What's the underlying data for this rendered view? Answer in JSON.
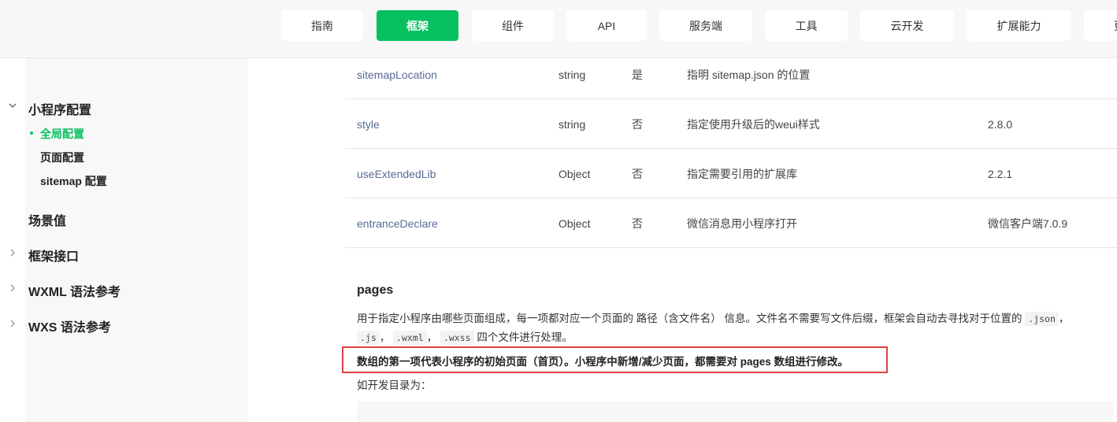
{
  "nav": {
    "items": [
      {
        "label": "指南",
        "active": false
      },
      {
        "label": "框架",
        "active": true
      },
      {
        "label": "组件",
        "active": false
      },
      {
        "label": "API",
        "active": false
      },
      {
        "label": "服务端",
        "active": false
      },
      {
        "label": "工具",
        "active": false
      },
      {
        "label": "云开发",
        "active": false
      },
      {
        "label": "扩展能力",
        "active": false
      },
      {
        "label": "更",
        "active": false
      }
    ],
    "accent": "#07c160"
  },
  "sidebar": {
    "section": "小程序配置",
    "subitems": [
      {
        "label": "全局配置",
        "active": true
      },
      {
        "label": "页面配置",
        "active": false
      },
      {
        "label": "sitemap 配置",
        "active": false
      }
    ],
    "items": [
      {
        "label": "场景值"
      },
      {
        "label": "框架接口"
      },
      {
        "label": "WXML 语法参考"
      },
      {
        "label": "WXS 语法参考"
      }
    ]
  },
  "table": {
    "rows": [
      {
        "name": "sitemapLocation",
        "type": "string",
        "required": "是",
        "desc": "指明 sitemap.json 的位置",
        "version": ""
      },
      {
        "name": "style",
        "type": "string",
        "required": "否",
        "desc": "指定使用升级后的weui样式",
        "version": "2.8.0"
      },
      {
        "name": "useExtendedLib",
        "type": "Object",
        "required": "否",
        "desc": "指定需要引用的扩展库",
        "version": "2.2.1"
      },
      {
        "name": "entranceDeclare",
        "type": "Object",
        "required": "否",
        "desc": "微信消息用小程序打开",
        "version": "微信客户端7.0.9"
      }
    ]
  },
  "pages_section": {
    "heading": "pages",
    "para1_a": "用于指定小程序由哪些页面组成，每一项都对应一个页面的 路径（含文件名） 信息。文件名不需要写文件后缀，框架会自动去寻找对于位置的",
    "code_json": ".json",
    "sep": "，",
    "code_js": ".js",
    "code_wxml": ".wxml",
    "code_wxss": ".wxss",
    "para1_b": "四个文件进行处理。",
    "highlight": "数组的第一项代表小程序的初始页面（首页）。小程序中新增/减少页面，都需要对 pages 数组进行修改。",
    "para2": "如开发目录为："
  }
}
